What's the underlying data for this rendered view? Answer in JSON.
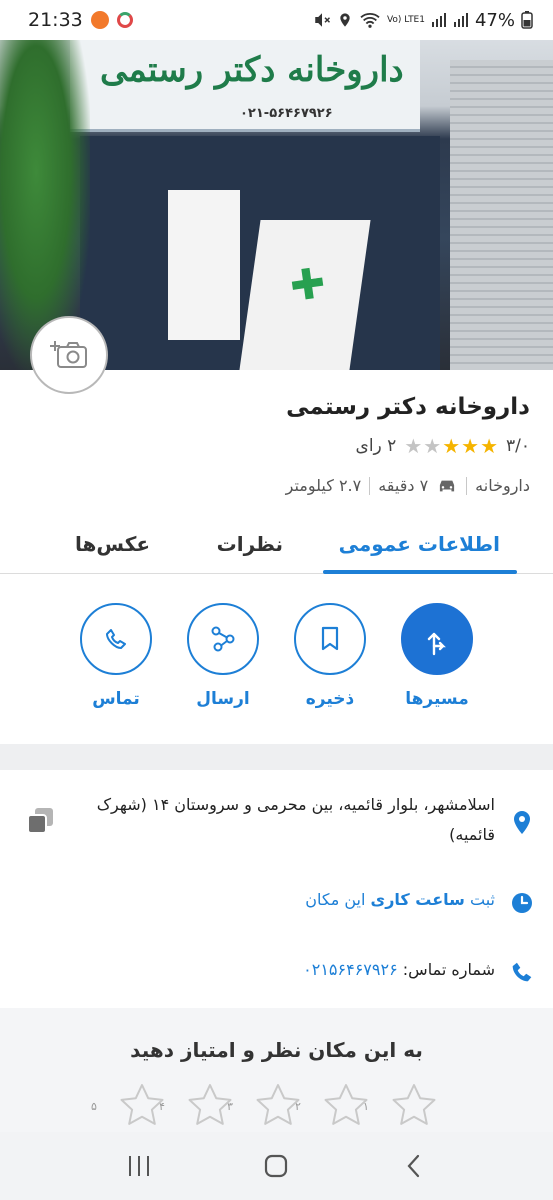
{
  "status_bar": {
    "time": "21:33",
    "network": "Vo) LTE1",
    "battery": "47%"
  },
  "place": {
    "name": "داروخانه دکتر رستمی",
    "rating": "۳/۰",
    "stars_filled": 3,
    "stars_total": 5,
    "reviews_count": "۲ رای",
    "category": "داروخانه",
    "drive_time": "۷ دقیقه",
    "distance": "۲.۷ کیلومتر"
  },
  "hero": {
    "sign_text": "داروخانه دکتر رستمی",
    "sign_phone": "۰۲۱-۵۶۴۶۷۹۲۶"
  },
  "tabs": [
    {
      "label": "اطلاعات عمومی",
      "active": true
    },
    {
      "label": "نظرات",
      "active": false
    },
    {
      "label": "عکس‌ها",
      "active": false
    }
  ],
  "actions": {
    "directions": "مسیرها",
    "save": "ذخیره",
    "share": "ارسال",
    "call": "تماس"
  },
  "details": {
    "address": "اسلامشهر، بلوار قائمیه، بین محرمی و سروستان ۱۴ (شهرک قائمیه)",
    "hours_prefix": "ثبت",
    "hours_bold": "ساعت کاری",
    "hours_suffix": "این مکان",
    "phone_label": "شماره تماس:",
    "phone_number": "۰۲۱۵۶۴۶۷۹۲۶"
  },
  "review_prompt": {
    "title": "به این مکان نظر و امتیاز دهید",
    "star_labels": [
      "۱",
      "۲",
      "۳",
      "۴",
      "۵"
    ]
  },
  "colors": {
    "accent": "#1d7fd6",
    "star": "#f5b400",
    "star_empty": "#c4c4c4"
  }
}
